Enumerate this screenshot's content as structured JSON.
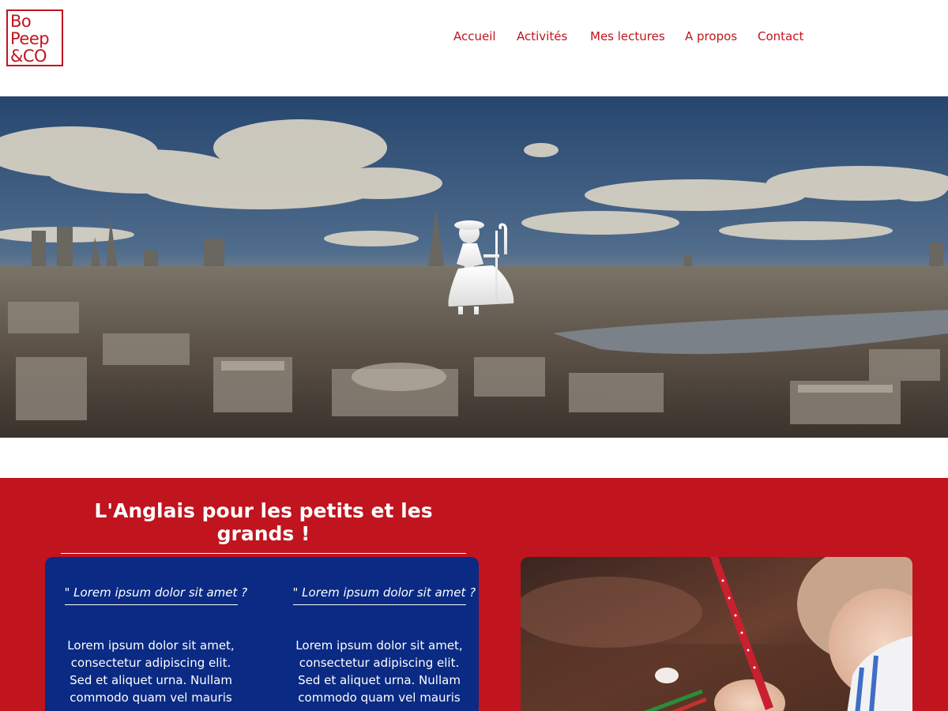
{
  "header": {
    "logo_lines": [
      "Bo",
      "Peep",
      "&CO"
    ],
    "nav": [
      "Accueil",
      "Activités",
      "Mes lectures",
      "A propos",
      "Contact"
    ]
  },
  "colors": {
    "brand_red": "#c0141e",
    "box_blue": "#0a2a83"
  },
  "hero": {
    "image": "london-panorama",
    "overlay_icon": "shepherdess-silhouette-icon"
  },
  "section": {
    "title": "L'Anglais pour les petits et les grands !",
    "columns": [
      {
        "quote": "\" Lorem ipsum dolor sit amet ?",
        "text": "Lorem ipsum dolor sit amet, consectetur adipiscing elit. Sed et aliquet urna. Nullam commodo quam vel mauris"
      },
      {
        "quote": "\" Lorem ipsum dolor sit amet ?",
        "text": "Lorem ipsum dolor sit amet, consectetur adipiscing elit. Sed et aliquet urna. Nullam commodo quam vel mauris"
      }
    ],
    "photo": "child-drawing-photo"
  }
}
